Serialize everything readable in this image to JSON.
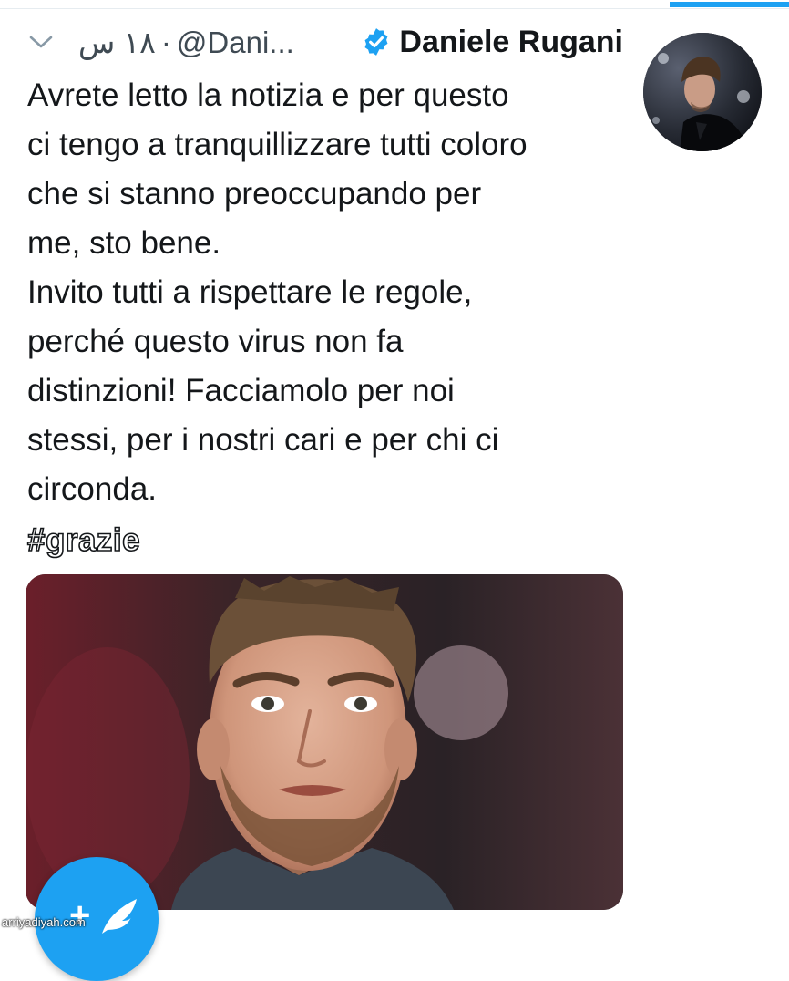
{
  "tweet": {
    "display_name": "Daniele Rugani",
    "handle": "@Dani...",
    "separator": "·",
    "time": "١٨ س",
    "text_lines": [
      "Avrete letto la notizia e per questo",
      "ci tengo a tranquillizzare tutti coloro",
      "che si stanno preoccupando per",
      "me, sto bene.",
      "Invito tutti a rispettare le regole,",
      "perché questo virus non fa",
      "distinzioni! Facciamolo per noi",
      "stessi, per i nostri cari e per chi ci",
      "circonda."
    ],
    "hashtag": "#grazie"
  },
  "fab": {
    "plus": "+"
  },
  "watermark": "arriyadiyah.com",
  "colors": {
    "accent": "#1da1f2",
    "text": "#14171a",
    "meta": "#3f4a53"
  },
  "icons": {
    "chevron": "chevron-down-icon",
    "verified": "verified-badge-icon",
    "compose": "compose-tweet-icon"
  }
}
